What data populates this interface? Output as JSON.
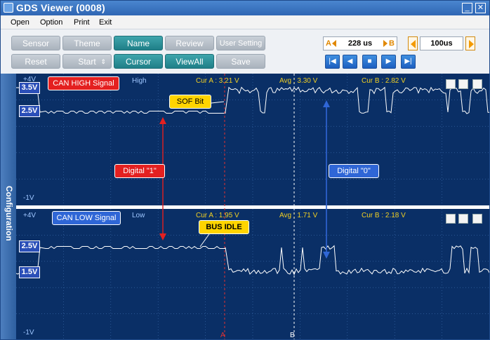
{
  "window": {
    "title": "GDS Viewer (0008)"
  },
  "menu": [
    "Open",
    "Option",
    "Print",
    "Exit"
  ],
  "toolbar": {
    "row1": [
      {
        "label": "Sensor",
        "active": false
      },
      {
        "label": "Theme",
        "active": false
      },
      {
        "label": "Name",
        "active": true
      },
      {
        "label": "Review",
        "active": false
      },
      {
        "label": "User Setting",
        "active": false
      }
    ],
    "row2": [
      {
        "label": "Reset",
        "active": false
      },
      {
        "label": "Start",
        "active": false
      },
      {
        "label": "Cursor",
        "active": true
      },
      {
        "label": "ViewAll",
        "active": true
      },
      {
        "label": "Save",
        "active": false
      }
    ],
    "start_spin_glyph": "⇕",
    "cursor_span_a": "A",
    "cursor_span_b": "B",
    "cursor_span_value": "228 us",
    "time_div_value": "100us"
  },
  "sidebar": {
    "label": "Configuration"
  },
  "channels": {
    "top": {
      "name": "CAN HIGH Signal",
      "level": "High",
      "cur_a": "Cur A : 3.21 V",
      "avg": "Avg : 3.30 V",
      "cur_b": "Cur B : 2.82 V",
      "y_top": "+4V",
      "y_bottom": "-1V",
      "badge_upper": "3.5V",
      "badge_lower": "2.5V"
    },
    "bottom": {
      "name": "CAN LOW Signal",
      "level": "Low",
      "cur_a": "Cur A : 1.95 V",
      "avg": "Avg : 1.71 V",
      "cur_b": "Cur B : 2.18 V",
      "y_top": "+4V",
      "y_bottom": "-1V",
      "badge_upper": "2.5V",
      "badge_lower": "1.5V"
    }
  },
  "annotations": {
    "sof": "SOF Bit",
    "digital1": "Digital \"1\"",
    "digital0": "Digital \"0\"",
    "bus_idle": "BUS IDLE"
  },
  "cursor_markers": {
    "a": "A",
    "b": "B"
  },
  "colors": {
    "plot_bg": "#0a2f66",
    "grid": "#3d6fb0",
    "signal": "#ffffff",
    "cursor_a": "#e23030",
    "cursor_b": "#ffffff",
    "accent_teal": "#1f7f88",
    "callout_red": "#e42020",
    "callout_blue": "#2f66d6",
    "callout_yellow": "#ffd400"
  },
  "icons": {
    "first": "skip-first-icon",
    "prev": "prev-icon",
    "stop": "stop-icon",
    "next": "next-icon",
    "last": "skip-last-icon"
  }
}
